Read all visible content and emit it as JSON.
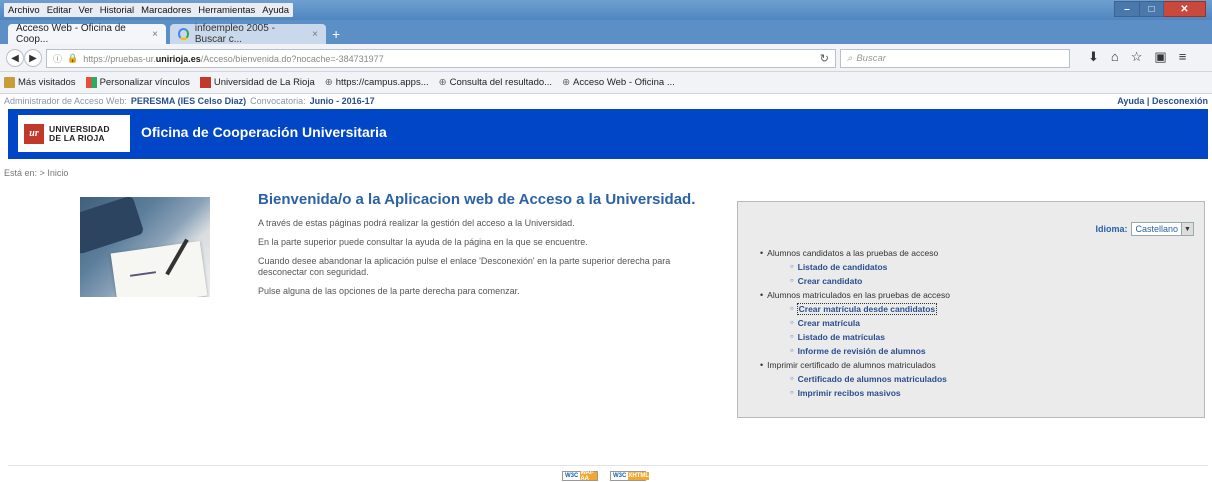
{
  "browser": {
    "menu": [
      "Archivo",
      "Editar",
      "Ver",
      "Historial",
      "Marcadores",
      "Herramientas",
      "Ayuda"
    ],
    "tabs": [
      {
        "label": "Acceso Web - Oficina de Coop...",
        "close": "×"
      },
      {
        "label": "infoempleo 2005 - Buscar c...",
        "close": "×"
      }
    ],
    "new_tab": "+",
    "url_prefix": "https://pruebas-ur.",
    "url_domain": "unirioja.es",
    "url_path": "/Acceso/bienvenida.do?nocache=-384731977",
    "search_placeholder": "Buscar",
    "bookmarks": [
      "Más visitados",
      "Personalizar vínculos",
      "Universidad de La Rioja",
      "https://campus.apps...",
      "Consulta del resultado...",
      "Acceso Web - Oficina ..."
    ]
  },
  "header": {
    "admin_label": "Administrador de Acceso Web:",
    "admin_name": "PERESMA (IES Celso Diaz)",
    "convocatoria_label": "Convocatoria:",
    "convocatoria_value": "Junio - 2016-17",
    "ayuda": "Ayuda",
    "separator": "|",
    "desconexion": "Desconexión"
  },
  "banner": {
    "logo_mark": "ur",
    "logo_line1": "UNIVERSIDAD",
    "logo_line2": "DE LA RIOJA",
    "title": "Oficina de Cooperación Universitaria"
  },
  "breadcrumb": {
    "label": "Está en:",
    "arrow": ">",
    "item": "Inicio"
  },
  "main": {
    "title": "Bienvenida/o a la Aplicacion web de Acceso a la Universidad.",
    "paragraphs": [
      "A través de estas páginas podrá realizar la gestión del acceso a la Universidad.",
      "En la parte superior puede consultar la ayuda de la página en la que se encuentre.",
      "Cuando desee abandonar la aplicación pulse el enlace 'Desconexión' en la parte superior derecha para desconectar con seguridad.",
      "Pulse alguna de las opciones de la parte derecha para comenzar."
    ]
  },
  "panel": {
    "idioma_label": "Idioma:",
    "idioma_value": "Castellano",
    "sections": [
      {
        "title": "Alumnos candidatos a las pruebas de acceso",
        "links": [
          "Listado de candidatos",
          "Crear candidato"
        ]
      },
      {
        "title": "Alumnos matriculados en las pruebas de acceso",
        "links": [
          "Crear matrícula desde candidatos",
          "Crear matrícula",
          "Listado de matrículas",
          "Informe de revisión de alumnos"
        ]
      },
      {
        "title": "Imprimir certificado de alumnos matriculados",
        "links": [
          "Certificado de alumnos matriculados",
          "Imprimir recibos masivos"
        ]
      }
    ]
  },
  "footer": {
    "badge1_left": "W3C",
    "badge1_right": "WAI-AA",
    "badge2_left": "W3C",
    "badge2_right": "XHTML"
  }
}
